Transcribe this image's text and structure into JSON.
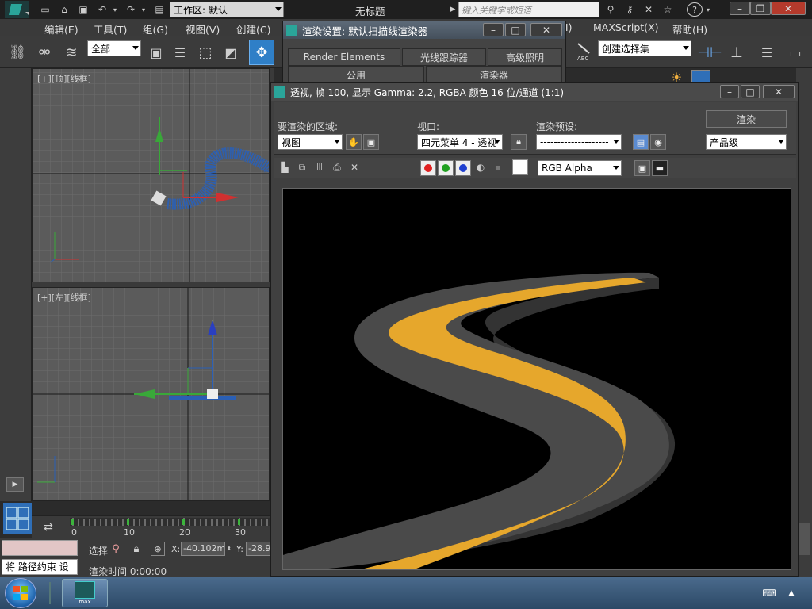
{
  "titlebar": {
    "workspace_label": "工作区: 默认",
    "title": "无标题",
    "search_placeholder": "键入关键字或短语"
  },
  "menubar": {
    "items": [
      "编辑(E)",
      "工具(T)",
      "组(G)",
      "视图(V)",
      "创建(C)",
      "(I)",
      "MAXScript(X)",
      "帮助(H)"
    ]
  },
  "toolbar": {
    "selection_filter": "全部",
    "named_selection": "创建选择集",
    "abc_label": "ABC"
  },
  "viewports": {
    "top_label": "[+][顶][线框]",
    "left_label": "[+][左][线框]"
  },
  "timeline": {
    "ticks": [
      "0",
      "10",
      "20",
      "30"
    ]
  },
  "status": {
    "select_label": "选择",
    "x_label": "X:",
    "x_value": "-40.102mm",
    "y_label": "Y:",
    "y_value": "-28.9",
    "prompt_text": "将 路径约束 设",
    "render_time": "渲染时间 0:00:00"
  },
  "render_setup": {
    "title": "渲染设置: 默认扫描线渲染器",
    "tabs": [
      "Render Elements",
      "光线跟踪器",
      "高级照明",
      "公用",
      "渲染器"
    ]
  },
  "frame_window": {
    "title": "透视, 帧 100, 显示 Gamma: 2.2, RGBA 颜色 16 位/通道 (1:1)",
    "area_label": "要渲染的区域:",
    "area_value": "视图",
    "viewport_label": "视口:",
    "viewport_value": "四元菜单 4 - 透视",
    "preset_label": "渲染预设:",
    "preset_value": "--------------------",
    "render_button": "渲染",
    "quality_value": "产品级",
    "channel_value": "RGB Alpha",
    "colors": {
      "road": "#4a4a4a",
      "road_side": "#333333",
      "stripe": "#e6a72c",
      "background": "#000000"
    }
  },
  "taskbar": {
    "app_label": "max"
  }
}
